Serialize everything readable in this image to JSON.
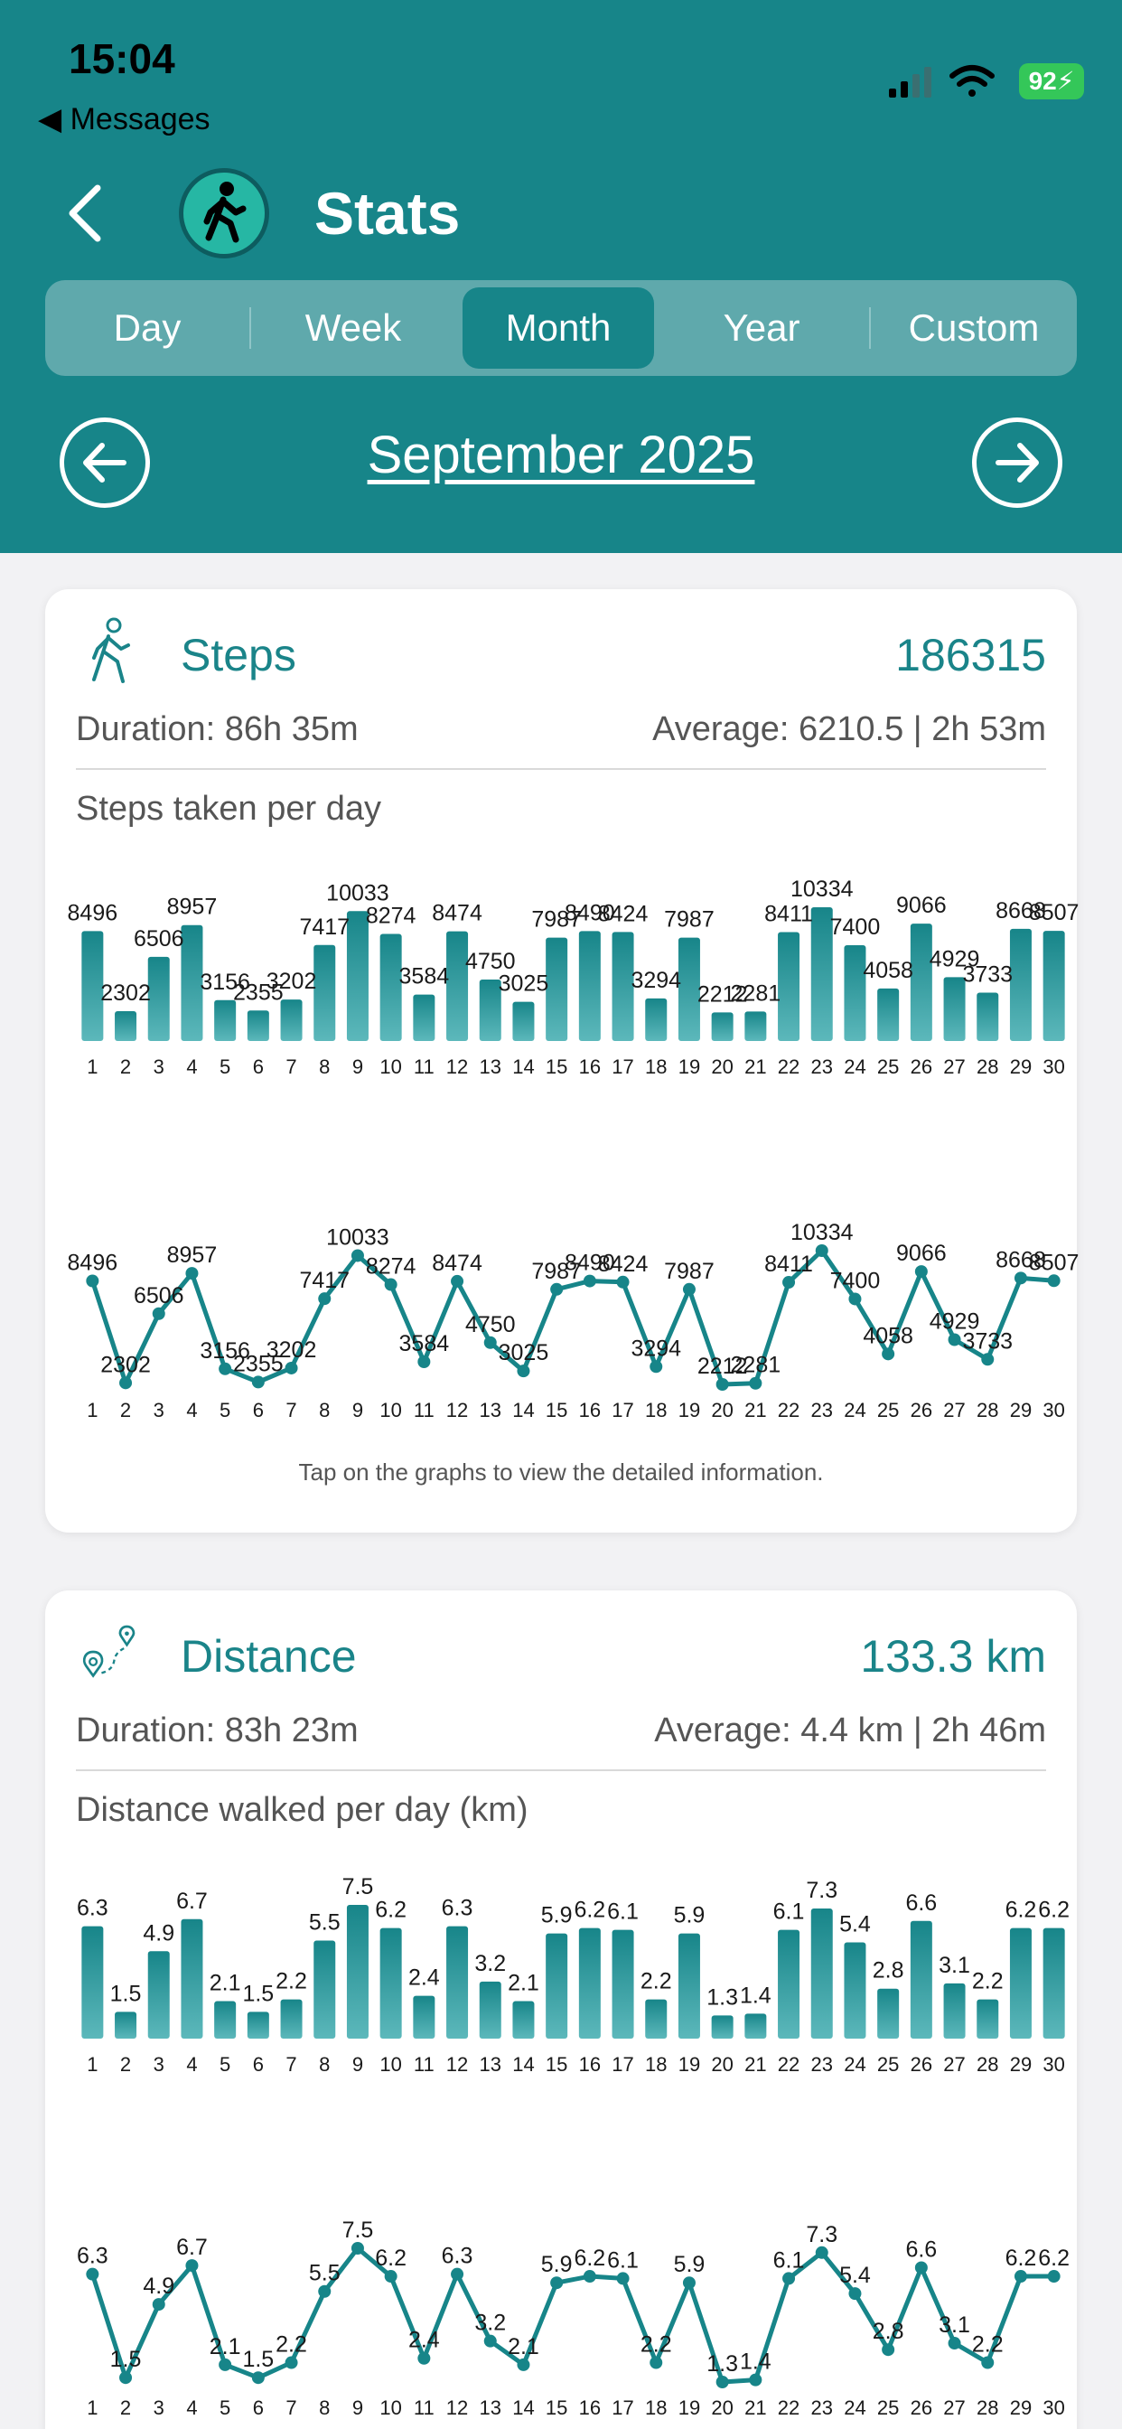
{
  "status_bar": {
    "time": "15:04",
    "back_label": "Messages",
    "battery": "92"
  },
  "header": {
    "title": "Stats"
  },
  "tabs": [
    {
      "label": "Day",
      "active": false
    },
    {
      "label": "Week",
      "active": false
    },
    {
      "label": "Month",
      "active": true
    },
    {
      "label": "Year",
      "active": false
    },
    {
      "label": "Custom",
      "active": false
    }
  ],
  "period": {
    "label": "September 2025"
  },
  "steps_card": {
    "title": "Steps",
    "total": "186315",
    "duration": "Duration: 86h 35m",
    "average": "Average: 6210.5 | 2h 53m",
    "chart_title": "Steps taken per day",
    "hint": "Tap on the graphs to view the detailed information."
  },
  "distance_card": {
    "title": "Distance",
    "total": "133.3 km",
    "duration": "Duration: 83h 23m",
    "average": "Average: 4.4 km | 2h 46m",
    "chart_title": "Distance walked per day (km)"
  },
  "colors": {
    "accent": "#178589",
    "tab_bar": "#5fa9ac",
    "bar_top": "#178589",
    "bar_bottom": "#5cb8bb"
  },
  "chart_data": [
    {
      "type": "bar",
      "categories": [
        "1",
        "2",
        "3",
        "4",
        "5",
        "6",
        "7",
        "8",
        "9",
        "10",
        "11",
        "12",
        "13",
        "14",
        "15",
        "16",
        "17",
        "18",
        "19",
        "20",
        "21",
        "22",
        "23",
        "24",
        "25",
        "26",
        "27",
        "28",
        "29",
        "30"
      ],
      "values": [
        8496,
        2302,
        6506,
        8957,
        3156,
        2355,
        3202,
        7417,
        10033,
        8274,
        3584,
        8474,
        4750,
        3025,
        7987,
        8490,
        8424,
        3294,
        7987,
        2212,
        2281,
        8411,
        10334,
        7400,
        4058,
        9066,
        4929,
        3733,
        8668,
        8507
      ],
      "ylim": [
        0,
        10334
      ]
    },
    {
      "type": "line",
      "categories": [
        "1",
        "2",
        "3",
        "4",
        "5",
        "6",
        "7",
        "8",
        "9",
        "10",
        "11",
        "12",
        "13",
        "14",
        "15",
        "16",
        "17",
        "18",
        "19",
        "20",
        "21",
        "22",
        "23",
        "24",
        "25",
        "26",
        "27",
        "28",
        "29",
        "30"
      ],
      "values": [
        8496,
        2302,
        6506,
        8957,
        3156,
        2355,
        3202,
        7417,
        10033,
        8274,
        3584,
        8474,
        4750,
        3025,
        7987,
        8490,
        8424,
        3294,
        7987,
        2212,
        2281,
        8411,
        10334,
        7400,
        4058,
        9066,
        4929,
        3733,
        8668,
        8507
      ],
      "ylim": [
        2212,
        10334
      ]
    },
    {
      "type": "bar",
      "categories": [
        "1",
        "2",
        "3",
        "4",
        "5",
        "6",
        "7",
        "8",
        "9",
        "10",
        "11",
        "12",
        "13",
        "14",
        "15",
        "16",
        "17",
        "18",
        "19",
        "20",
        "21",
        "22",
        "23",
        "24",
        "25",
        "26",
        "27",
        "28",
        "29",
        "30"
      ],
      "values": [
        6.3,
        1.5,
        4.9,
        6.7,
        2.1,
        1.5,
        2.2,
        5.5,
        7.5,
        6.2,
        2.4,
        6.3,
        3.2,
        2.1,
        5.9,
        6.2,
        6.1,
        2.2,
        5.9,
        1.3,
        1.4,
        6.1,
        7.3,
        5.4,
        2.8,
        6.6,
        3.1,
        2.2,
        6.2,
        6.2
      ],
      "ylim": [
        0,
        7.5
      ]
    },
    {
      "type": "line",
      "categories": [
        "1",
        "2",
        "3",
        "4",
        "5",
        "6",
        "7",
        "8",
        "9",
        "10",
        "11",
        "12",
        "13",
        "14",
        "15",
        "16",
        "17",
        "18",
        "19",
        "20",
        "21",
        "22",
        "23",
        "24",
        "25",
        "26",
        "27",
        "28",
        "29",
        "30"
      ],
      "values": [
        6.3,
        1.5,
        4.9,
        6.7,
        2.1,
        1.5,
        2.2,
        5.5,
        7.5,
        6.2,
        2.4,
        6.3,
        3.2,
        2.1,
        5.9,
        6.2,
        6.1,
        2.2,
        5.9,
        1.3,
        1.4,
        6.1,
        7.3,
        5.4,
        2.8,
        6.6,
        3.1,
        2.2,
        6.2,
        6.2
      ],
      "ylim": [
        1.3,
        7.5
      ]
    }
  ]
}
